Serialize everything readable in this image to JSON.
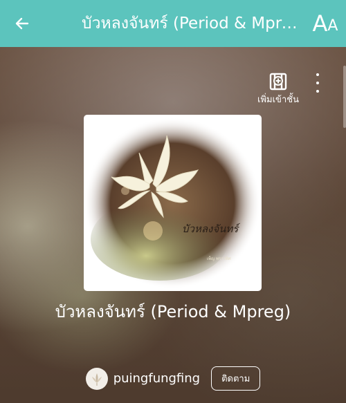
{
  "header": {
    "title": "บัวหลงจันทร์ (Period & Mpreg)",
    "font_size_big": "A",
    "font_size_small": "A",
    "bg_color": "#5cc4bd"
  },
  "actions": {
    "add_to_library_label": "เพิ่มเข้าชั้น"
  },
  "cover": {
    "text": "บัวหลงจันทร์",
    "author_small": "เพ็ญ พราวพิศ"
  },
  "book": {
    "title": "บัวหลงจันทร์ (Period & Mpreg)"
  },
  "author": {
    "name": "puingfungfing",
    "follow_label": "ติดตาม"
  }
}
